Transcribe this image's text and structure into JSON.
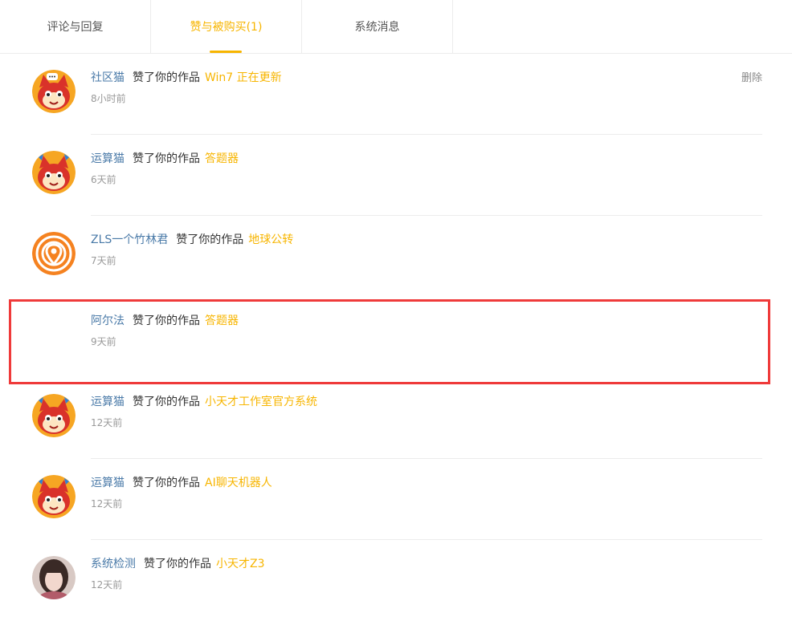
{
  "tabs": [
    {
      "label": "评论与回复",
      "active": false
    },
    {
      "label": "赞与被购买(1)",
      "active": true
    },
    {
      "label": "系统消息",
      "active": false
    }
  ],
  "colors": {
    "accent": "#f7b500",
    "user": "#4a7aa8",
    "highlight": "#ef3a3a"
  },
  "delete_label": "删除",
  "items": [
    {
      "user": "社区猫",
      "action": "赞了你的作品",
      "work": "Win7 正在更新",
      "time": "8小时前",
      "avatar": "cat-mascot-avatar"
    },
    {
      "user": "运算猫",
      "action": "赞了你的作品",
      "work": "答题器",
      "time": "6天前",
      "avatar": "cat-mascot-avatar"
    },
    {
      "user": "ZLS一个竹林君",
      "action": "赞了你的作品",
      "work": "地球公转",
      "time": "7天前",
      "avatar": "orange-location-avatar"
    },
    {
      "user": "阿尔法",
      "action": "赞了你的作品",
      "work": "答题器",
      "time": "9天前",
      "avatar": "blank-avatar"
    },
    {
      "user": "运算猫",
      "action": "赞了你的作品",
      "work": "小天才工作室官方系统",
      "time": "12天前",
      "avatar": "cat-mascot-avatar"
    },
    {
      "user": "运算猫",
      "action": "赞了你的作品",
      "work": "AI聊天机器人",
      "time": "12天前",
      "avatar": "cat-mascot-avatar"
    },
    {
      "user": "系统检测",
      "action": "赞了你的作品",
      "work": "小天才Z3",
      "time": "12天前",
      "avatar": "photo-avatar"
    }
  ]
}
